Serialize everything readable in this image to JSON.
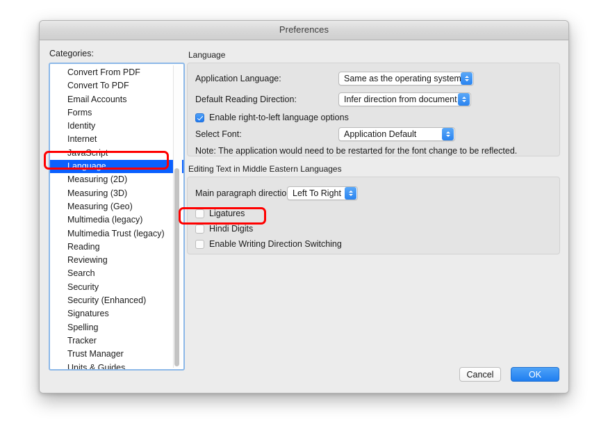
{
  "window": {
    "title": "Preferences"
  },
  "sidebar": {
    "label": "Categories:",
    "items": [
      {
        "label": "Convert From PDF",
        "selected": false
      },
      {
        "label": "Convert To PDF",
        "selected": false
      },
      {
        "label": "Email Accounts",
        "selected": false
      },
      {
        "label": "Forms",
        "selected": false
      },
      {
        "label": "Identity",
        "selected": false
      },
      {
        "label": "Internet",
        "selected": false
      },
      {
        "label": "JavaScript",
        "selected": false
      },
      {
        "label": "Language",
        "selected": true
      },
      {
        "label": "Measuring (2D)",
        "selected": false
      },
      {
        "label": "Measuring (3D)",
        "selected": false
      },
      {
        "label": "Measuring (Geo)",
        "selected": false
      },
      {
        "label": "Multimedia (legacy)",
        "selected": false
      },
      {
        "label": "Multimedia Trust (legacy)",
        "selected": false
      },
      {
        "label": "Reading",
        "selected": false
      },
      {
        "label": "Reviewing",
        "selected": false
      },
      {
        "label": "Search",
        "selected": false
      },
      {
        "label": "Security",
        "selected": false
      },
      {
        "label": "Security (Enhanced)",
        "selected": false
      },
      {
        "label": "Signatures",
        "selected": false
      },
      {
        "label": "Spelling",
        "selected": false
      },
      {
        "label": "Tracker",
        "selected": false
      },
      {
        "label": "Trust Manager",
        "selected": false
      },
      {
        "label": "Units & Guides",
        "selected": false
      }
    ]
  },
  "language_group": {
    "title": "Language",
    "application_language": {
      "label": "Application Language:",
      "value": "Same as the operating system"
    },
    "default_reading_direction": {
      "label": "Default Reading Direction:",
      "value": "Infer direction from document"
    },
    "enable_rtl": {
      "label": "Enable right-to-left language options",
      "checked": true
    },
    "select_font": {
      "label": "Select Font:",
      "value": "Application Default"
    },
    "note": "Note: The application would need to be restarted for the font change to be reflected."
  },
  "editing_group": {
    "title": "Editing Text in Middle Eastern Languages",
    "main_paragraph_direction": {
      "label": "Main paragraph direction:",
      "value": "Left To Right"
    },
    "ligatures": {
      "label": "Ligatures",
      "checked": false
    },
    "hindi_digits": {
      "label": "Hindi Digits",
      "checked": false
    },
    "writing_direction_switching": {
      "label": "Enable Writing Direction Switching",
      "checked": false
    }
  },
  "footer": {
    "cancel_label": "Cancel",
    "ok_label": "OK"
  },
  "annotations": {
    "color": "#ff0000",
    "targets": [
      "Language",
      "Hindi Digits"
    ]
  }
}
